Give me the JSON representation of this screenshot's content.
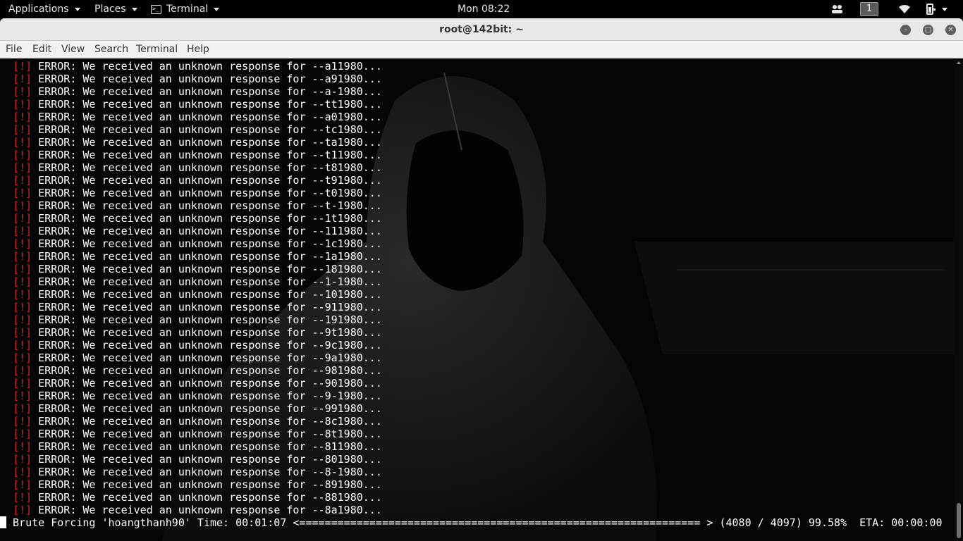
{
  "topbar": {
    "applications": "Applications",
    "places": "Places",
    "terminal": "Terminal",
    "clock": "Mon 08:22",
    "workspace": "1"
  },
  "window": {
    "title": "root@142bit: ~",
    "minimize_icon": "minimize-icon",
    "maximize_icon": "maximize-icon",
    "close_icon": "close-icon"
  },
  "menu": {
    "file": "File",
    "edit": "Edit",
    "view": "View",
    "search": "Search",
    "terminal": "Terminal",
    "help": "Help"
  },
  "terminal": {
    "prefix": "[!]",
    "message": " ERROR: We received an unknown response for ",
    "lines": [
      "--a11980...",
      "--a91980...",
      "--a-1980...",
      "--tt1980...",
      "--a01980...",
      "--tc1980...",
      "--ta1980...",
      "--t11980...",
      "--t81980...",
      "--t91980...",
      "--t01980...",
      "--t-1980...",
      "--1t1980...",
      "--111980...",
      "--1c1980...",
      "--1a1980...",
      "--181980...",
      "--1-1980...",
      "--101980...",
      "--911980...",
      "--191980...",
      "--9t1980...",
      "--9c1980...",
      "--9a1980...",
      "--981980...",
      "--901980...",
      "--9-1980...",
      "--991980...",
      "--8c1980...",
      "--8t1980...",
      "--811980...",
      "--801980...",
      "--8-1980...",
      "--891980...",
      "--881980...",
      "--8a1980..."
    ],
    "status": " Brute Forcing 'hoangthanh90' Time: 00:01:07 <=============================================================== > (4080 / 4097) 99.58%  ETA: 00:00:00"
  },
  "colors": {
    "error_bang": "#d72020",
    "terminal_fg": "#ffffff",
    "terminal_bg": "#050505",
    "titlebar_bg": "#e8e8e7"
  }
}
